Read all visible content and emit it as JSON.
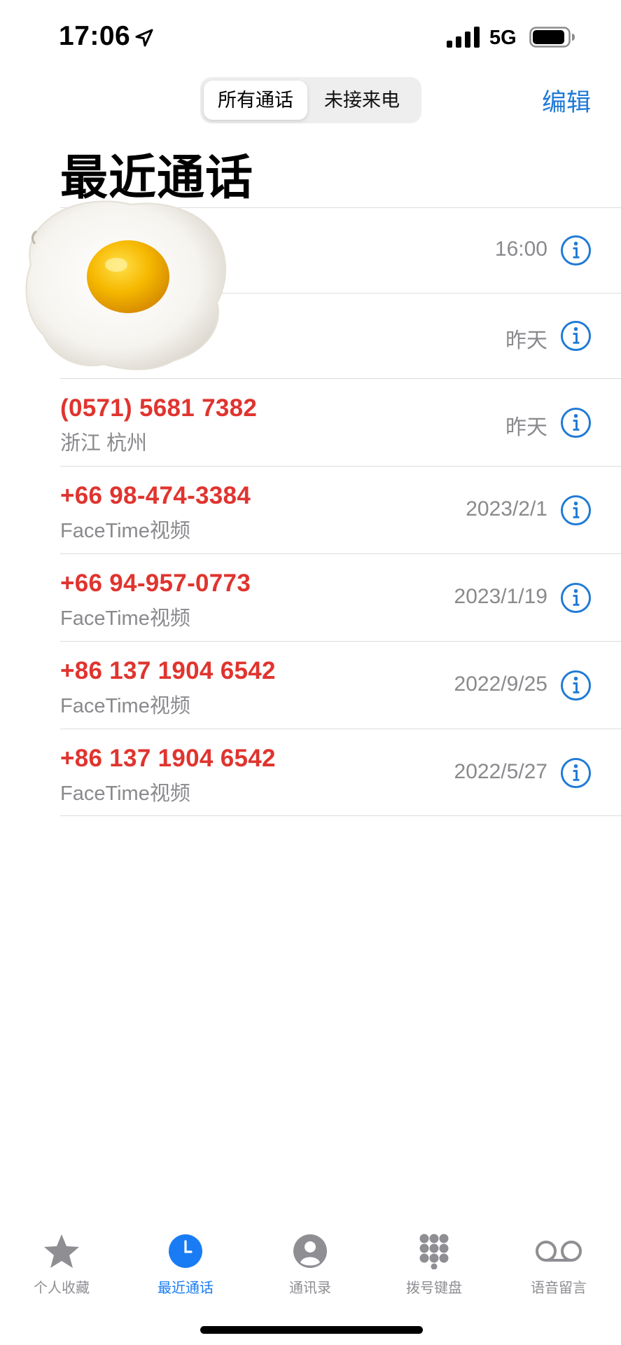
{
  "status_bar": {
    "time": "17:06",
    "network": "5G"
  },
  "header": {
    "segments": [
      "所有通话",
      "未接来电"
    ],
    "selected_segment": "所有通话",
    "edit_label": "编辑",
    "title": "最近通话"
  },
  "calls": [
    {
      "caller": "",
      "subtitle": "",
      "when": "16:00",
      "missed": true
    },
    {
      "caller": "",
      "subtitle": "",
      "when": "昨天",
      "missed": true
    },
    {
      "caller": "(0571) 5681 7382",
      "subtitle": "浙江 杭州",
      "when": "昨天",
      "missed": true
    },
    {
      "caller": "+66 98-474-3384",
      "subtitle": "FaceTime视频",
      "when": "2023/2/1",
      "missed": true
    },
    {
      "caller": "+66 94-957-0773",
      "subtitle": "FaceTime视频",
      "when": "2023/1/19",
      "missed": true
    },
    {
      "caller": "+86 137 1904 6542",
      "subtitle": "FaceTime视频",
      "when": "2022/9/25",
      "missed": true
    },
    {
      "caller": "+86 137 1904 6542",
      "subtitle": "FaceTime视频",
      "when": "2022/5/27",
      "missed": true
    }
  ],
  "tab_bar": {
    "tabs": [
      {
        "label": "个人收藏",
        "icon": "star-icon"
      },
      {
        "label": "最近通话",
        "icon": "clock-icon"
      },
      {
        "label": "通讯录",
        "icon": "person-icon"
      },
      {
        "label": "拨号键盘",
        "icon": "keypad-icon"
      },
      {
        "label": "语音留言",
        "icon": "voicemail-icon"
      }
    ],
    "active": "最近通话"
  },
  "colors": {
    "accent": "#1f7ad6",
    "missed": "#e0342f",
    "secondary_text": "#8a8a8e",
    "tab_active": "#1a7cf4",
    "tab_inactive": "#8e8e93"
  }
}
